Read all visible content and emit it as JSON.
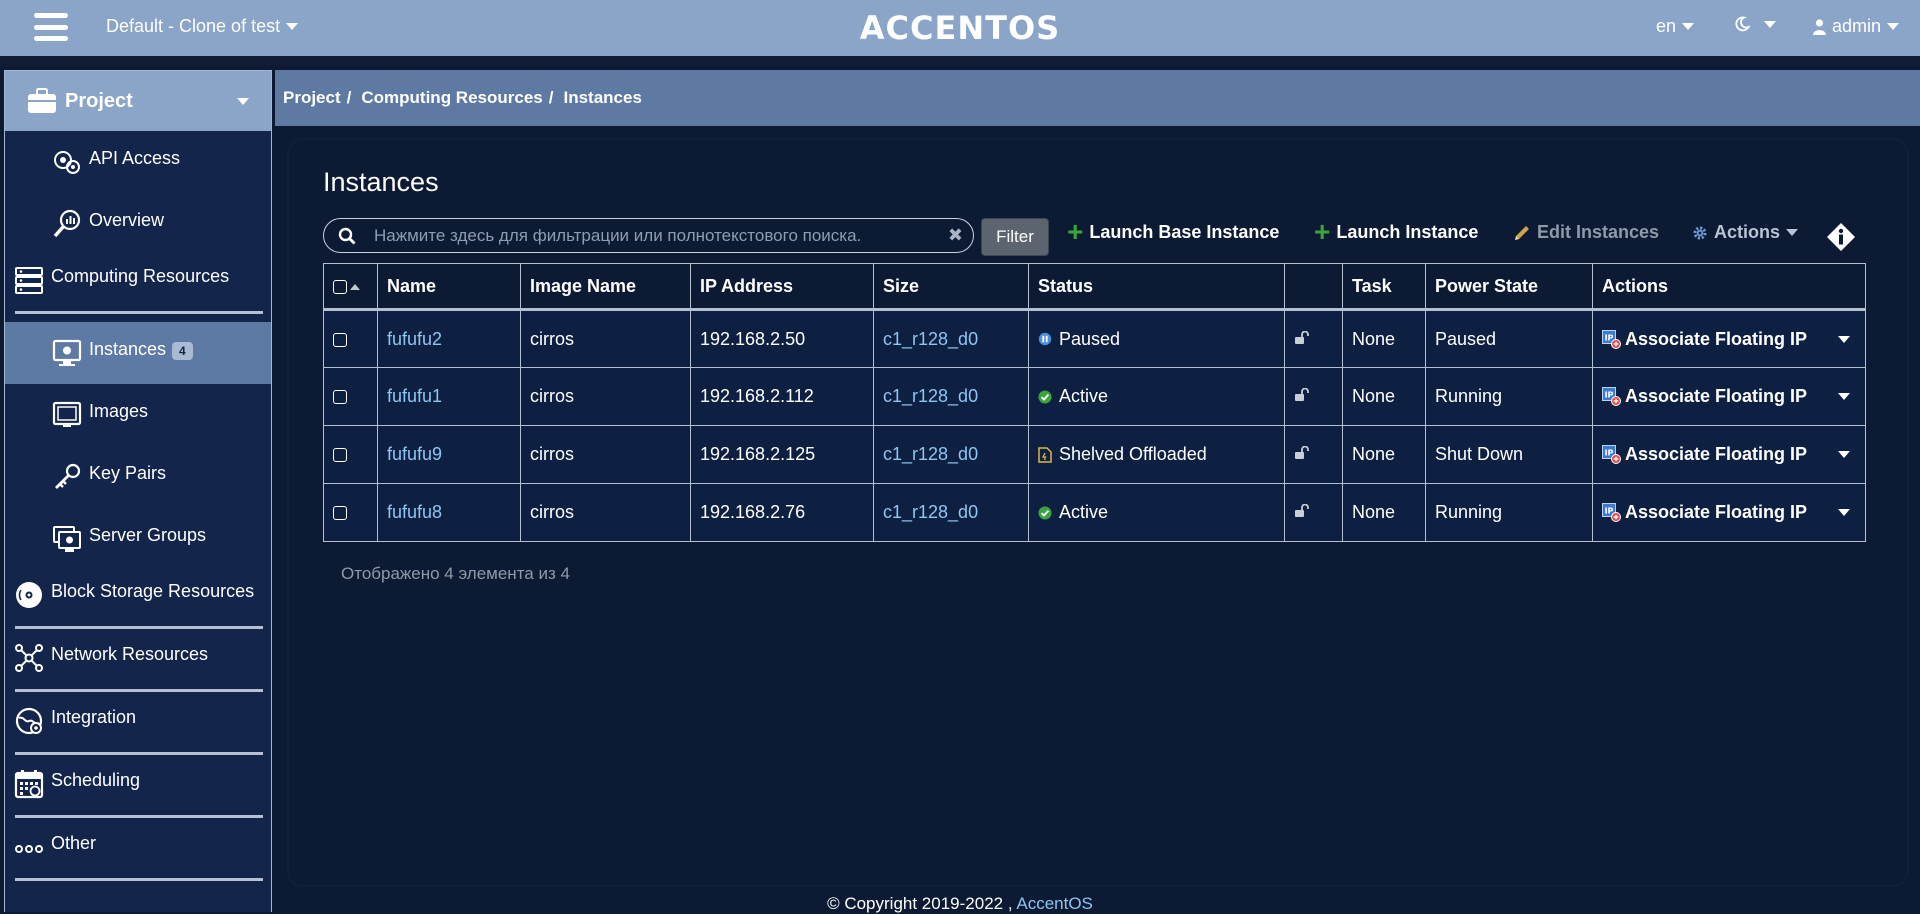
{
  "topbar": {
    "project_select": "Default - Clone of test",
    "brand": "ACCENTOS",
    "language": "en",
    "user": "admin",
    "menu_icon": "hamburger-icon",
    "theme_icon": "moon-icon",
    "user_icon": "user-icon"
  },
  "sidebar": {
    "header": "Project",
    "items": [
      {
        "label": "API Access",
        "icon": "api-access-icon"
      },
      {
        "label": "Overview",
        "icon": "overview-icon"
      },
      {
        "label": "Computing Resources",
        "icon": "server-icon"
      },
      {
        "label": "Instances",
        "icon": "monitor-icon",
        "badge": "4"
      },
      {
        "label": "Images",
        "icon": "image-icon"
      },
      {
        "label": "Key Pairs",
        "icon": "key-icon"
      },
      {
        "label": "Server Groups",
        "icon": "server-group-icon"
      },
      {
        "label": "Block Storage Resources",
        "icon": "disk-icon"
      },
      {
        "label": "Network Resources",
        "icon": "network-icon"
      },
      {
        "label": "Integration",
        "icon": "integration-icon"
      },
      {
        "label": "Scheduling",
        "icon": "calendar-icon"
      },
      {
        "label": "Other",
        "icon": "dots-icon"
      }
    ]
  },
  "breadcrumb": {
    "items": [
      "Project",
      "Computing Resources",
      "Instances"
    ],
    "separator": "/"
  },
  "main": {
    "title": "Instances",
    "search_placeholder": "Нажмите здесь для фильтрации или полнотекстового поиска.",
    "filter_label": "Filter",
    "launch_base_label": "Launch Base Instance",
    "launch_label": "Launch Instance",
    "edit_label": "Edit Instances",
    "actions_label": "Actions",
    "columns": [
      "Name",
      "Image Name",
      "IP Address",
      "Size",
      "Status",
      "",
      "Task",
      "Power State",
      "Actions"
    ],
    "rows": [
      {
        "name": "fufufu2",
        "image": "cirros",
        "ip": "192.168.2.50",
        "size": "c1_r128_d0",
        "status": "Paused",
        "status_icon": "paused-icon",
        "task": "None",
        "power": "Paused",
        "action": "Associate Floating IP"
      },
      {
        "name": "fufufu1",
        "image": "cirros",
        "ip": "192.168.2.112",
        "size": "c1_r128_d0",
        "status": "Active",
        "status_icon": "active-check-icon",
        "task": "None",
        "power": "Running",
        "action": "Associate Floating IP"
      },
      {
        "name": "fufufu9",
        "image": "cirros",
        "ip": "192.168.2.125",
        "size": "c1_r128_d0",
        "status": "Shelved Offloaded",
        "status_icon": "shelved-icon",
        "task": "None",
        "power": "Shut Down",
        "action": "Associate Floating IP"
      },
      {
        "name": "fufufu8",
        "image": "cirros",
        "ip": "192.168.2.76",
        "size": "c1_r128_d0",
        "status": "Active",
        "status_icon": "active-check-icon",
        "task": "None",
        "power": "Running",
        "action": "Associate Floating IP"
      }
    ],
    "count_text": "Отображено 4 элемента из 4"
  },
  "footer": {
    "text": "© Copyright 2019-2022 ,",
    "link": "AccentOS"
  },
  "colors": {
    "topbar": "#8aa5c8",
    "sidebar_bg": "#13254a",
    "active_item": "#5d7aa5",
    "page_bg": "#0c1a33",
    "link": "#8ec5f2",
    "success": "#3aa53a"
  }
}
